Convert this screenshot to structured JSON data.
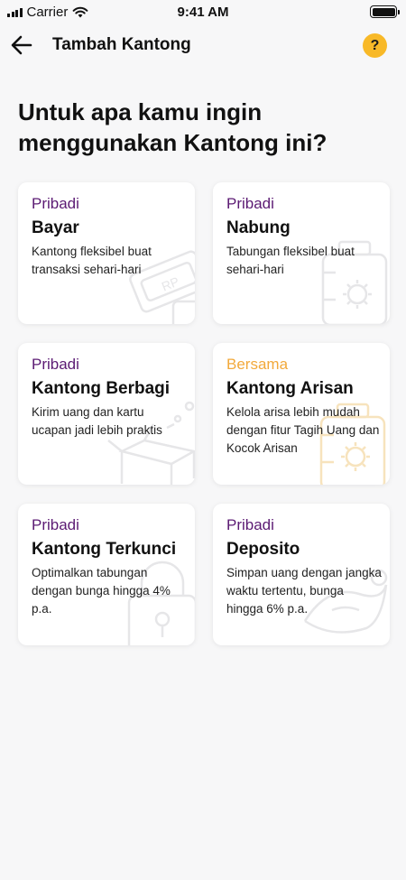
{
  "status_bar": {
    "carrier": "Carrier",
    "time": "9:41 AM"
  },
  "nav": {
    "title": "Tambah Kantong",
    "help_label": "?"
  },
  "heading": "Untuk apa kamu ingin menggunakan Kantong ini?",
  "colors": {
    "accent_purple": "#5b1a73",
    "accent_orange": "#f2a93b",
    "help_yellow": "#f8b928"
  },
  "cards": [
    {
      "tag": "Pribadi",
      "title": "Bayar",
      "desc": "Kantong fleksibel buat transaksi sehari-hari",
      "icon": "money-card-icon"
    },
    {
      "tag": "Pribadi",
      "title": "Nabung",
      "desc": "Tabungan fleksibel buat sehari-hari",
      "icon": "savings-jar-icon"
    },
    {
      "tag": "Pribadi",
      "title": "Kantong Berbagi",
      "desc": "Kirim uang dan kartu ucapan jadi lebih praktis",
      "icon": "gift-box-icon"
    },
    {
      "tag": "Bersama",
      "title": "Kantong Arisan",
      "desc": "Kelola arisa lebih mudah dengan fitur Tagih Uang dan Kocok Arisan",
      "icon": "arisan-jar-icon"
    },
    {
      "tag": "Pribadi",
      "title": "Kantong Terkunci",
      "desc": "Optimalkan tabungan dengan bunga hingga 4% p.a.",
      "icon": "lock-icon"
    },
    {
      "tag": "Pribadi",
      "title": "Deposito",
      "desc": "Simpan uang dengan jangka waktu tertentu, bunga hingga 6% p.a.",
      "icon": "deposit-icon"
    }
  ]
}
